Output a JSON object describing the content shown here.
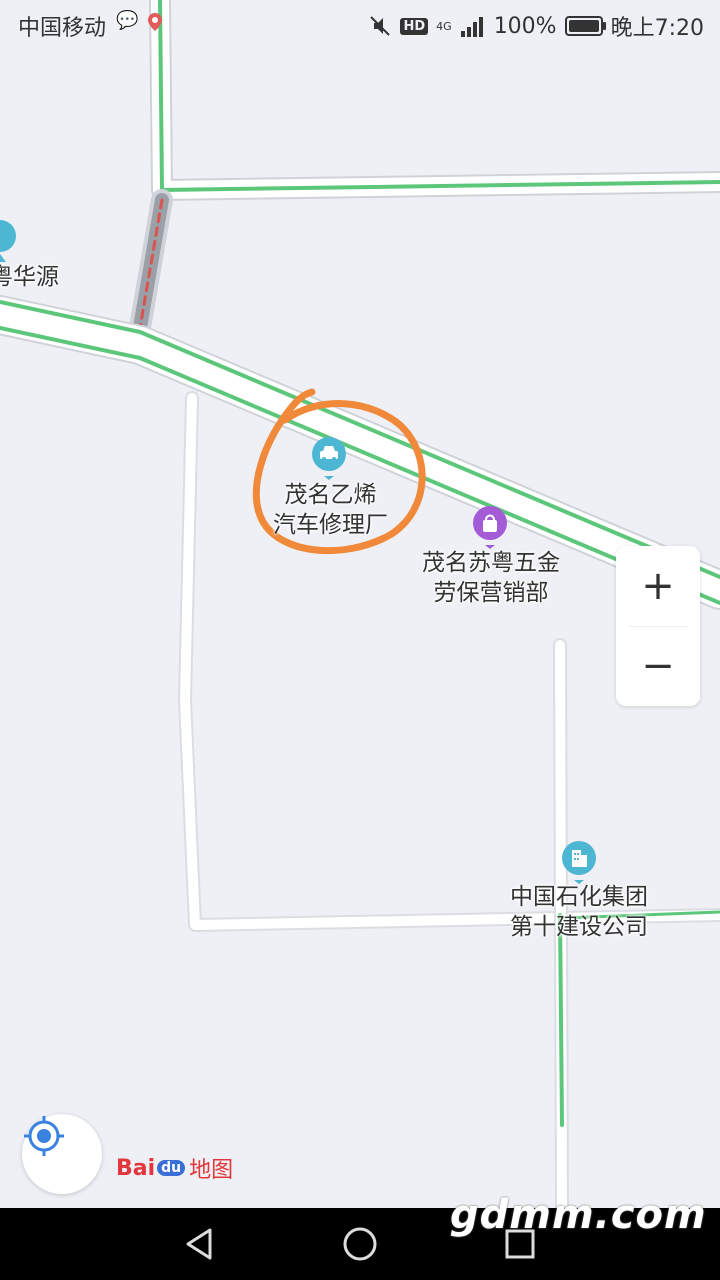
{
  "status_bar": {
    "carrier": "中国移动",
    "battery": "100%",
    "time": "晚上7:20",
    "hd": "HD",
    "network": "4G",
    "icons": [
      "wechat-icon",
      "location-pin-icon",
      "mute-icon",
      "signal-icon",
      "battery-icon"
    ]
  },
  "map": {
    "pois": [
      {
        "label_line1": "粤华源",
        "label_line2": "",
        "icon": "poi-generic-icon"
      },
      {
        "label_line1": "茂名乙烯",
        "label_line2": "汽车修理厂",
        "icon": "car-repair-icon",
        "color": "#4db6d3"
      },
      {
        "label_line1": "茂名苏粤五金",
        "label_line2": "劳保营销部",
        "icon": "shopping-bag-icon",
        "color": "#a35bd6"
      },
      {
        "label_line1": "中国石化集团",
        "label_line2": "第十建设公司",
        "icon": "building-icon",
        "color": "#4db6d3"
      }
    ],
    "annotation_color": "#f08a3a",
    "road_color": "#5cc77a"
  },
  "controls": {
    "zoom_in": "+",
    "zoom_out": "−",
    "logo_bai": "Bai",
    "logo_du": "du",
    "logo_map": "地图"
  },
  "watermark": "gdmm.com"
}
